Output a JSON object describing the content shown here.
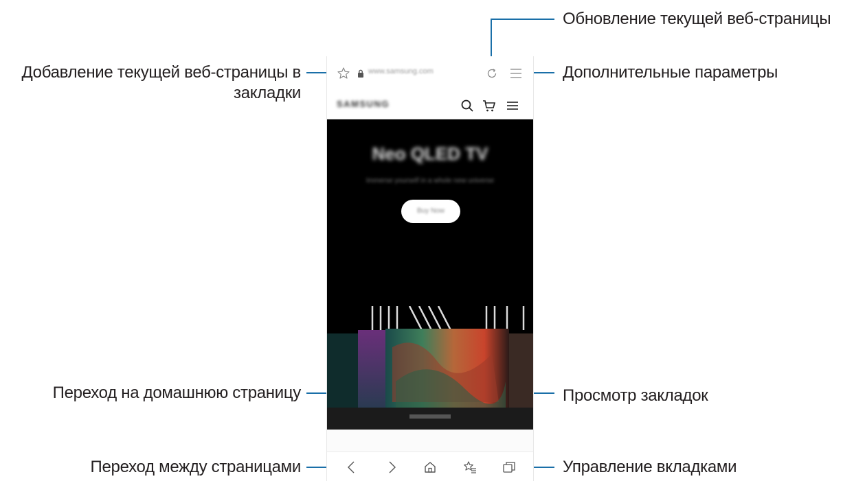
{
  "browser": {
    "url": "www.samsung.com",
    "site_logo": "SAMSUNG"
  },
  "hero": {
    "title": "Neo QLED TV",
    "subtitle": "Immerse yourself in a whole new universe",
    "button": "Buy Now"
  },
  "callouts": {
    "refresh": "Обновление текущей веб-страницы",
    "bookmark_add": "Добавление текущей веб-страницы в закладки",
    "more_options": "Дополнительные параметры",
    "home": "Переход на домашнюю страницу",
    "bookmarks_view": "Просмотр закладок",
    "navigate": "Переход между страницами",
    "tabs_manage": "Управление вкладками"
  },
  "icons": {
    "bookmark_add": "star-icon",
    "lock": "lock-icon",
    "refresh": "refresh-icon",
    "menu": "menu-icon",
    "search": "search-icon",
    "cart": "cart-icon",
    "site_menu": "hamburger-icon",
    "back": "chevron-left-icon",
    "forward": "chevron-right-icon",
    "home": "home-icon",
    "bookmarks": "bookmarks-icon",
    "tabs": "tabs-icon"
  },
  "colors": {
    "leader_line": "#1a6fa8",
    "icon_gray": "#8a8a8a",
    "hero_background": "#000000"
  }
}
